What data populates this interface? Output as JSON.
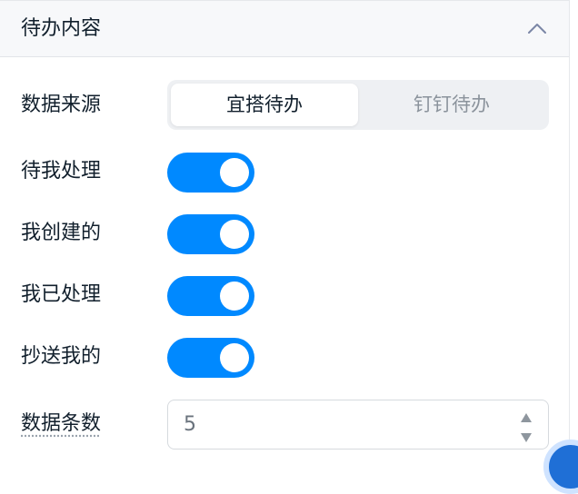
{
  "panel": {
    "title": "待办内容",
    "collapse_icon": "chevron-up-icon"
  },
  "data_source": {
    "label": "数据来源",
    "options": [
      "宜搭待办",
      "钉钉待办"
    ],
    "selected": "宜搭待办"
  },
  "toggles": [
    {
      "label": "待我处理",
      "on": true
    },
    {
      "label": "我创建的",
      "on": true
    },
    {
      "label": "我已处理",
      "on": true
    },
    {
      "label": "抄送我的",
      "on": true
    }
  ],
  "count": {
    "label": "数据条数",
    "value": "5"
  },
  "colors": {
    "accent": "#0089ff",
    "text": "#111f2c",
    "muted": "#8b939c"
  }
}
